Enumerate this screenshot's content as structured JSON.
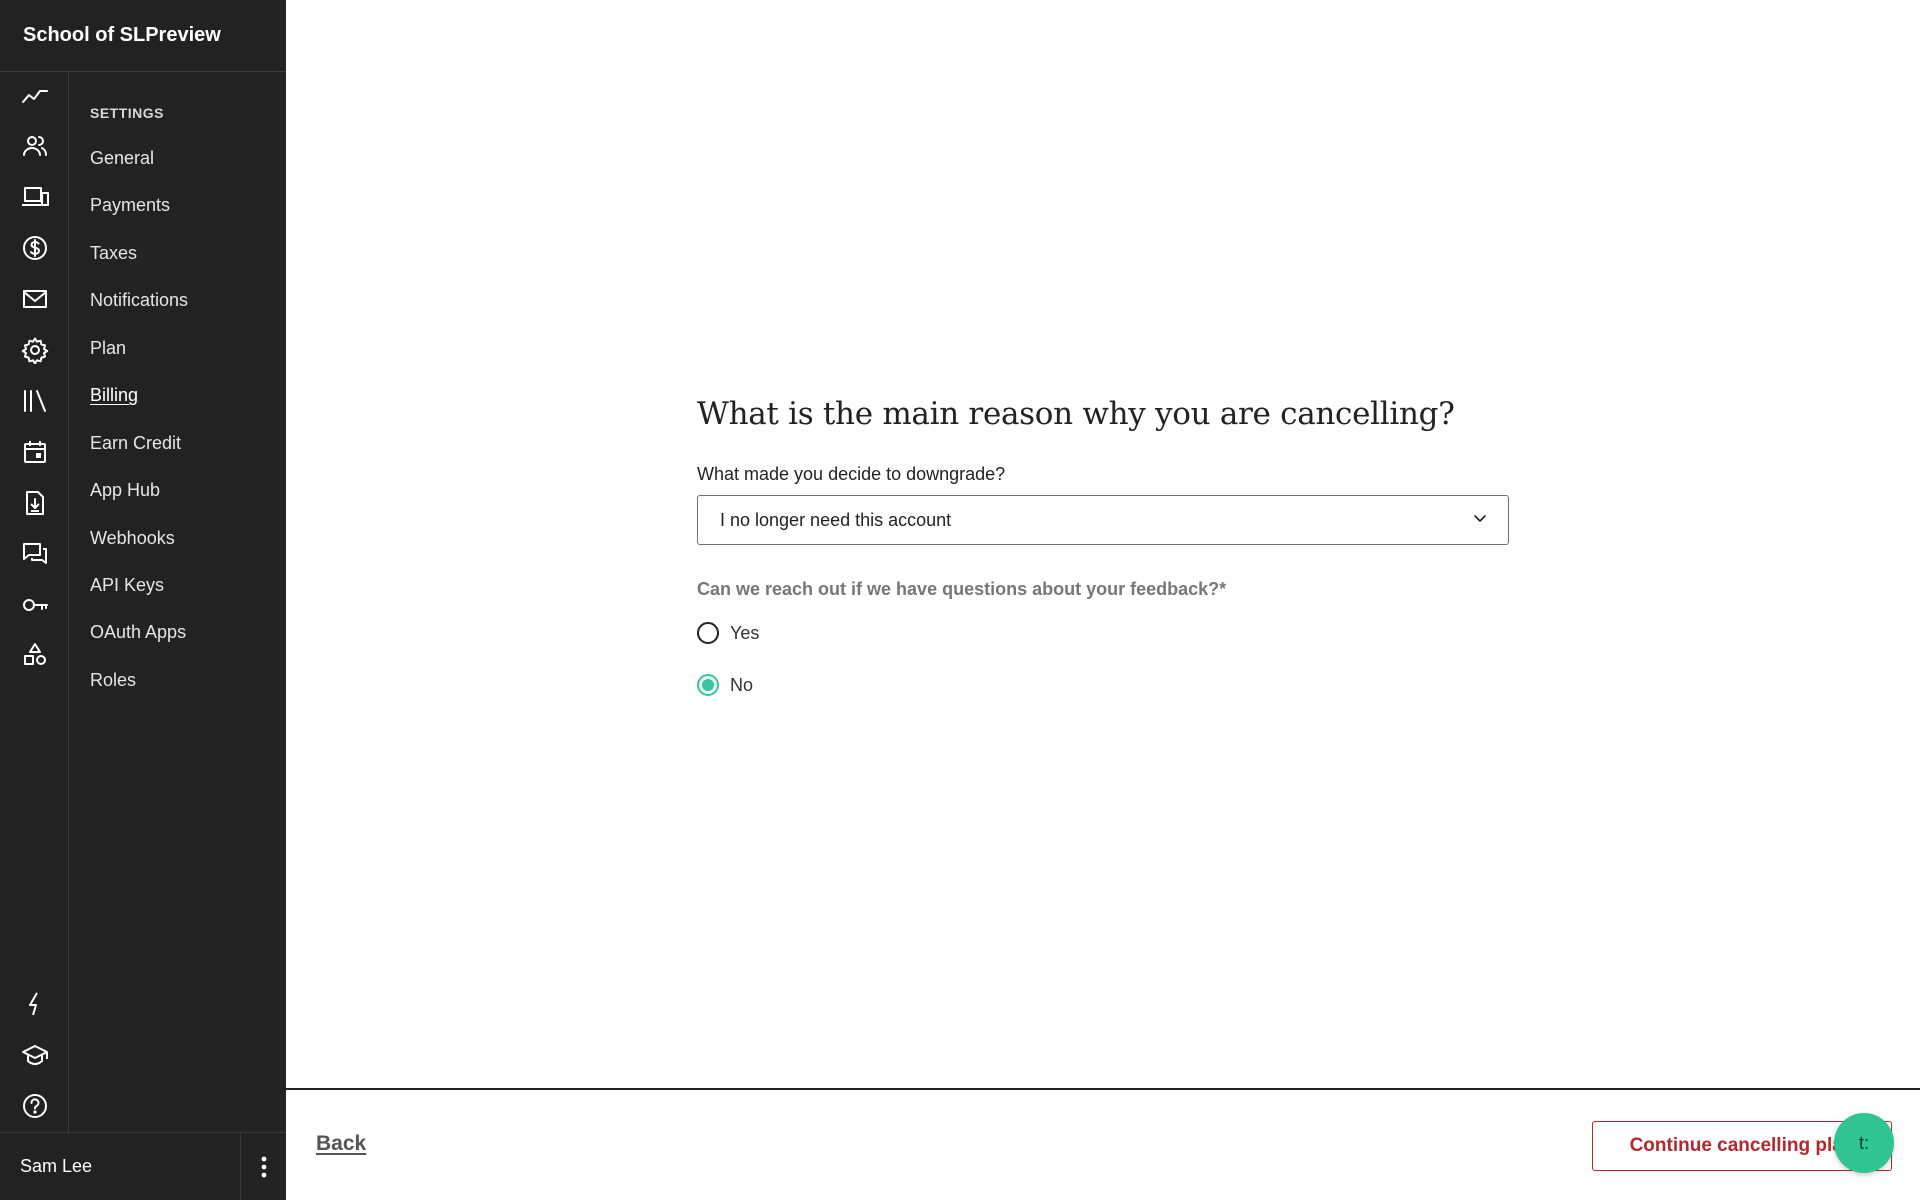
{
  "sidebar": {
    "brand": "School of SLPreview",
    "rail_icons": [
      "analytics-icon",
      "users-icon",
      "devices-icon",
      "dollar-icon",
      "mail-icon",
      "gear-icon",
      "library-icon",
      "calendar-icon",
      "download-file-icon",
      "chat-icon",
      "key-icon",
      "shapes-icon",
      "lightning-icon",
      "graduation-cap-icon",
      "help-icon"
    ],
    "settings_heading": "SETTINGS",
    "items": [
      {
        "label": "General"
      },
      {
        "label": "Payments"
      },
      {
        "label": "Taxes"
      },
      {
        "label": "Notifications"
      },
      {
        "label": "Plan"
      },
      {
        "label": "Billing",
        "active": true
      },
      {
        "label": "Earn Credit"
      },
      {
        "label": "App Hub"
      },
      {
        "label": "Webhooks"
      },
      {
        "label": "API Keys"
      },
      {
        "label": "OAuth Apps"
      },
      {
        "label": "Roles"
      }
    ],
    "user_name": "Sam Lee"
  },
  "main": {
    "title": "What is the main reason why you are cancelling?",
    "select_label": "What made you decide to downgrade?",
    "select_value": "I no longer need this account",
    "radio_question": "Can we reach out if we have questions about your feedback?*",
    "radio_options": [
      {
        "label": "Yes",
        "checked": false
      },
      {
        "label": "No",
        "checked": true
      }
    ]
  },
  "footer": {
    "back_label": "Back",
    "continue_label": "Continue cancelling plan"
  },
  "chat_button": {
    "label": "t:"
  },
  "colors": {
    "sidebar_bg": "#222222",
    "accent_green": "#3ac4a0",
    "danger_red": "#b3272d"
  }
}
